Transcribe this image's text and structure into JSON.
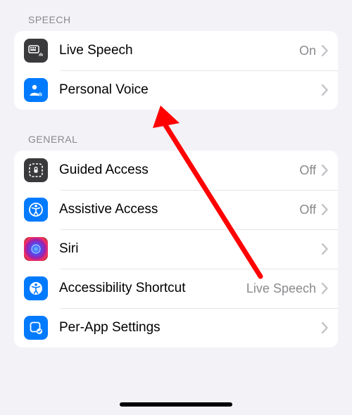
{
  "sections": {
    "speech": {
      "header": "SPEECH",
      "rows": {
        "live_speech": {
          "label": "Live Speech",
          "value": "On",
          "icon": "live-speech-icon"
        },
        "personal_voice": {
          "label": "Personal Voice",
          "value": "",
          "icon": "personal-voice-icon"
        }
      }
    },
    "general": {
      "header": "GENERAL",
      "rows": {
        "guided_access": {
          "label": "Guided Access",
          "value": "Off",
          "icon": "guided-access-icon"
        },
        "assistive_access": {
          "label": "Assistive Access",
          "value": "Off",
          "icon": "assistive-access-icon"
        },
        "siri": {
          "label": "Siri",
          "value": "",
          "icon": "siri-icon"
        },
        "accessibility_shortcut": {
          "label": "Accessibility Shortcut",
          "value": "Live Speech",
          "icon": "accessibility-shortcut-icon"
        },
        "per_app_settings": {
          "label": "Per-App Settings",
          "value": "",
          "icon": "per-app-settings-icon"
        }
      }
    }
  },
  "annotation": {
    "type": "arrow",
    "target": "personal_voice",
    "color": "#ff0000"
  }
}
